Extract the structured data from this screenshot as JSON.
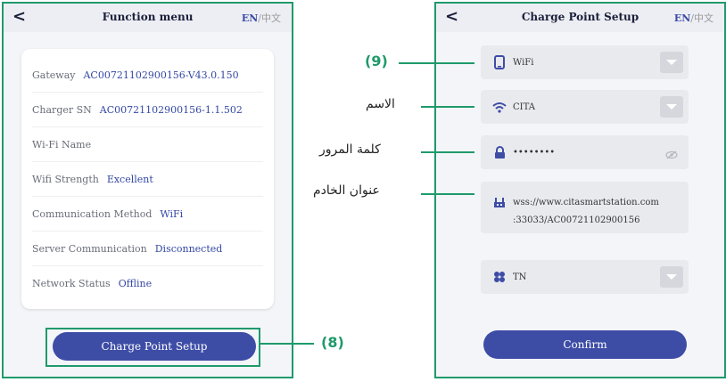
{
  "left_screen": {
    "title": "Function menu",
    "lang_en": "EN",
    "lang_sep": "/",
    "lang_zh": "中文",
    "back": "<",
    "info": [
      {
        "key": "Gateway",
        "value": "AC00721102900156-V43.0.150"
      },
      {
        "key": "Charger SN",
        "value": "AC00721102900156-1.1.502"
      },
      {
        "key": "Wi-Fi Name",
        "value": ""
      },
      {
        "key": "Wifi Strength",
        "value": "Excellent"
      },
      {
        "key": "Communication Method",
        "value": "WiFi"
      },
      {
        "key": "Server Communication",
        "value": "Disconnected"
      },
      {
        "key": "Network Status",
        "value": "Offline"
      }
    ],
    "button": "Charge Point Setup"
  },
  "right_screen": {
    "title": "Charge Point Setup",
    "lang_en": "EN",
    "lang_sep": "/",
    "lang_zh": "中文",
    "back": "<",
    "mode": {
      "icon": "phone-icon",
      "value": "WiFi"
    },
    "ssid": {
      "icon": "wifi-icon",
      "value": "CITA"
    },
    "password": {
      "icon": "lock-icon",
      "value": "••••••••"
    },
    "server_url_line1": "wss://www.citasmartstation.com",
    "server_url_line2": ":33033/AC00721102900156",
    "country": {
      "icon": "flag-icon",
      "value": "TN"
    },
    "button": "Confirm"
  },
  "callouts": {
    "label_9": "(9)",
    "label_8": "(8)",
    "name": "الاسم",
    "password": "كلمة المرور",
    "server": "عنوان الخادم"
  },
  "colors": {
    "accent": "#1f9a6b",
    "primary": "#3d4da6"
  }
}
